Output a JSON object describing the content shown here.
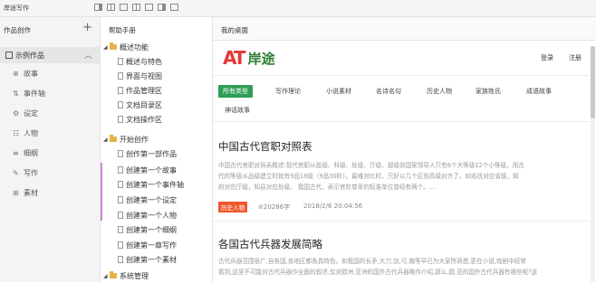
{
  "app": {
    "title": "岸途写作"
  },
  "left_panel": {
    "title": "作品创作",
    "add_symbol": "+",
    "sample": {
      "label": "示例作品"
    },
    "items": [
      {
        "icon": "⊕",
        "label": "故事"
      },
      {
        "icon": "⇅",
        "label": "事件轴"
      },
      {
        "icon": "⚙",
        "label": "设定"
      },
      {
        "icon": "☷",
        "label": "人物"
      },
      {
        "icon": "≡",
        "label": "细纲"
      },
      {
        "icon": "✎",
        "label": "写作"
      },
      {
        "icon": "⊞",
        "label": "素材"
      }
    ]
  },
  "help_panel": {
    "title": "帮助手册",
    "tree": [
      {
        "type": "folder",
        "label": "概述功能"
      },
      {
        "type": "doc",
        "label": "概述与特色"
      },
      {
        "type": "doc",
        "label": "界面与视图"
      },
      {
        "type": "doc",
        "label": "作品管理区"
      },
      {
        "type": "doc",
        "label": "文档目录区"
      },
      {
        "type": "doc",
        "label": "文档操作区"
      },
      {
        "type": "folder",
        "label": "开始创作"
      },
      {
        "type": "doc",
        "label": "创作第一部作品"
      },
      {
        "type": "doc",
        "label": "创建第一个故事"
      },
      {
        "type": "doc",
        "label": "创建第一个事件轴"
      },
      {
        "type": "doc",
        "label": "创建第一个设定"
      },
      {
        "type": "doc",
        "label": "创建第一个人物"
      },
      {
        "type": "doc",
        "label": "创建第一个细纲"
      },
      {
        "type": "doc",
        "label": "创建第一章写作"
      },
      {
        "type": "doc",
        "label": "创建第一个素材"
      },
      {
        "type": "folder",
        "label": "系统管理"
      }
    ]
  },
  "main": {
    "tab": "我的桌面",
    "brand": {
      "mark": "AT",
      "name": "岸途"
    },
    "header": {
      "login": "登录",
      "register": "注册"
    },
    "categories": [
      "所有类型",
      "写作理论",
      "小说素材",
      "名诗名句",
      "历史人物",
      "家族姓氏",
      "成语故事",
      "神话故事"
    ],
    "articles": [
      {
        "title": "中国古代官职对照表",
        "body_line1": "中国古代官职对照表概述:现代官职从股级、科级、处级、厅级、部级到国家领导人只有6个大等级12个小等级，而古",
        "body_line2": "代的等级从品级建立时就有9品18级（9品30阶）。最难对比时，只好以几个区别高级对齐了。如巡抚对应省级，知",
        "body_line3": "府对应厅级，知县对应处级。 我国古代，表示官阶尊卑的标准单位曾经有两个。...",
        "tag": "历史人物",
        "words": "⊘20286字",
        "date": "2018/2/6 20:04:56"
      },
      {
        "title": "各国古代兵器发展简略",
        "body_line1": "古代兵器范围很广,自各国,各地区都各具特色。如我国的长矛,大刀,剑,弓,戟等早已为大家所熟悉,更在小说,戏剧中经常",
        "body_line2": "看到,这里不可能对古代兵器作全面的叙述,仅对欧洲,亚洲的国外古代兵器略作介绍,那么,欧,亚的国外古代兵器有哪些呢?这"
      }
    ]
  }
}
